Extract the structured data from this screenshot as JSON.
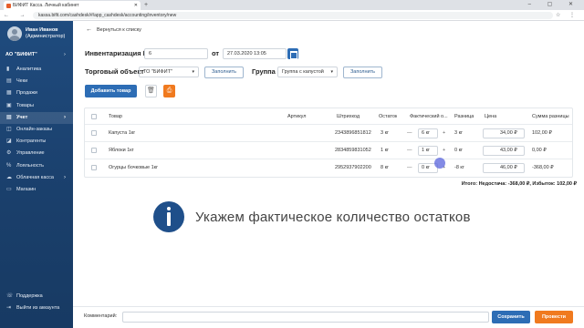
{
  "browser": {
    "tab_title": "БИФИТ Касса. Личный кабинет",
    "new_tab": "+",
    "window_controls": "– ▢ ✕",
    "nav_icons": "← → ⟳",
    "url": "kassa.bifit.com/cashdesk/#/app_cashdesk/accounting/inventory/new",
    "right_icons": "☆ ⋮"
  },
  "sidebar": {
    "user_name": "Иван Иванов",
    "user_role": "(Администратор)",
    "company": "АО \"БИФИТ\"",
    "company_chevron": "›",
    "items": [
      {
        "label": "Аналитика",
        "icon": "▮"
      },
      {
        "label": "Чеки",
        "icon": "▤"
      },
      {
        "label": "Продажи",
        "icon": "▦"
      },
      {
        "label": "Товары",
        "icon": "▣"
      },
      {
        "label": "Учет",
        "icon": "▤",
        "arrow": "›"
      },
      {
        "label": "Онлайн-заказы",
        "icon": "◫"
      },
      {
        "label": "Контрагенты",
        "icon": "◪"
      },
      {
        "label": "Управление",
        "icon": "⚙"
      },
      {
        "label": "Лояльность",
        "icon": "%"
      },
      {
        "label": "Облачная касса",
        "icon": "☁",
        "arrow": "›"
      },
      {
        "label": "Магазин",
        "icon": "▭"
      }
    ],
    "support": {
      "label": "Поддержка",
      "icon": "☏"
    },
    "logout": {
      "label": "Выйти из аккаунта",
      "icon": "⇥"
    }
  },
  "header": {
    "back_arrow": "←",
    "back_label": "Вернуться к списку"
  },
  "form": {
    "inv_label": "Инвентаризация №",
    "inv_number": "6",
    "date_label": "от",
    "date_value": "27.03.2020 13:05",
    "trade_label": "Торговый объект",
    "trade_value": "ТО \"БИФИТ\"",
    "fill_button": "Заполнить",
    "group_label": "Группа",
    "group_value": "Группа с капустой",
    "fill_button2": "Заполнить",
    "add_button": "Добавить товар",
    "dropdown_arrow": "▾",
    "trash_icon": "🗑",
    "print_icon": "⎙"
  },
  "table": {
    "headers": [
      "Товар",
      "Артикул",
      "Штрихкод",
      "Остаток",
      "Фактический о...",
      "Разница",
      "Цена",
      "Сумма разницы"
    ],
    "rows": [
      {
        "name": "Капуста 1кг",
        "article": "",
        "barcode": "2343896851812",
        "stock": "3 кг",
        "actual": "6 кг",
        "diff": "3 кг",
        "price": "34,00 ₽",
        "sum": "102,00 ₽"
      },
      {
        "name": "Яблоки 1кг",
        "article": "",
        "barcode": "2834859831052",
        "stock": "1 кг",
        "actual": "1 кг",
        "diff": "0 кг",
        "price": "43,00 ₽",
        "sum": "0,00 ₽"
      },
      {
        "name": "Огурцы бочковые 1кг",
        "article": "",
        "barcode": "2952937902200",
        "stock": "8 кг",
        "actual": "0 кг",
        "diff": "-8 кг",
        "price": "46,00 ₽",
        "sum": "-368,00 ₽"
      }
    ],
    "minus": "—"
  },
  "totals": "Итого: Недостача: -368,00 ₽, Избыток: 102,00 ₽",
  "overlay_text": "Укажем фактическое количество остатков",
  "footer": {
    "comment_label": "Комментарий:",
    "save_button": "Сохранить",
    "post_button": "Провести"
  },
  "colors": {
    "primary": "#2d6db5",
    "accent": "#f07a1f",
    "sidebar": "#1f4b7e"
  }
}
